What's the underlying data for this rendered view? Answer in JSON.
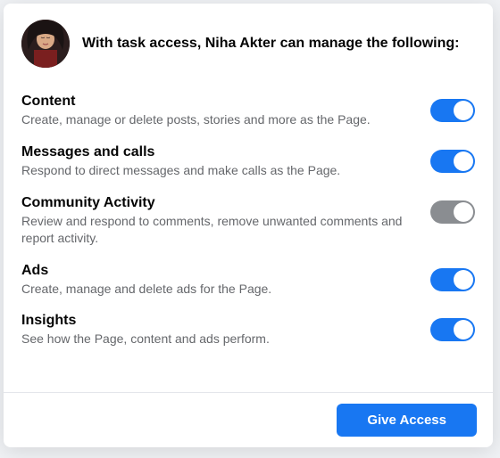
{
  "header": {
    "text": "With task access, Niha Akter can manage the following:"
  },
  "permissions": [
    {
      "title": "Content",
      "description": "Create, manage or delete posts, stories and more as the Page.",
      "enabled": true
    },
    {
      "title": "Messages and calls",
      "description": "Respond to direct messages and make calls as the Page.",
      "enabled": true
    },
    {
      "title": "Community Activity",
      "description": "Review and respond to comments, remove unwanted comments and report activity.",
      "enabled": false
    },
    {
      "title": "Ads",
      "description": "Create, manage and delete ads for the Page.",
      "enabled": true
    },
    {
      "title": "Insights",
      "description": "See how the Page, content and ads perform.",
      "enabled": true
    }
  ],
  "footer": {
    "give_access_label": "Give Access"
  }
}
